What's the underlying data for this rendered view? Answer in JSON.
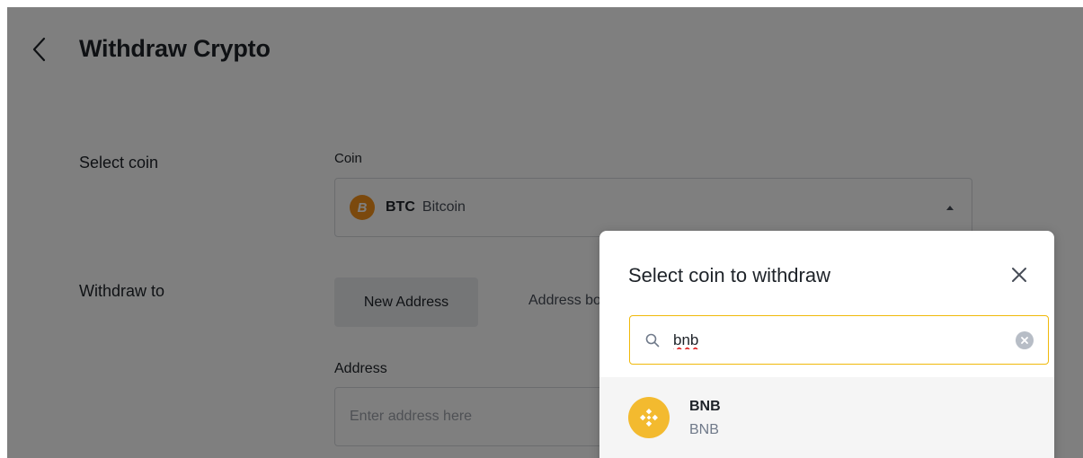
{
  "header": {
    "title": "Withdraw Crypto"
  },
  "form": {
    "select_coin_label": "Select coin",
    "coin_caption": "Coin",
    "selected_coin": {
      "symbol": "BTC",
      "name": "Bitcoin",
      "badge": "B",
      "color": "#f7931a"
    },
    "withdraw_to_label": "Withdraw to",
    "tabs": {
      "new_address": "New Address",
      "address_book": "Address book"
    },
    "address_caption": "Address",
    "address_placeholder": "Enter address here"
  },
  "modal": {
    "title": "Select coin to withdraw",
    "search_value": "bnb",
    "results": [
      {
        "symbol": "BNB",
        "name": "BNB",
        "color": "#f3ba2f"
      }
    ]
  },
  "colors": {
    "accent": "#f0b90b",
    "text": "#1e2329",
    "overlay": "rgba(0,0,0,0.5)"
  }
}
